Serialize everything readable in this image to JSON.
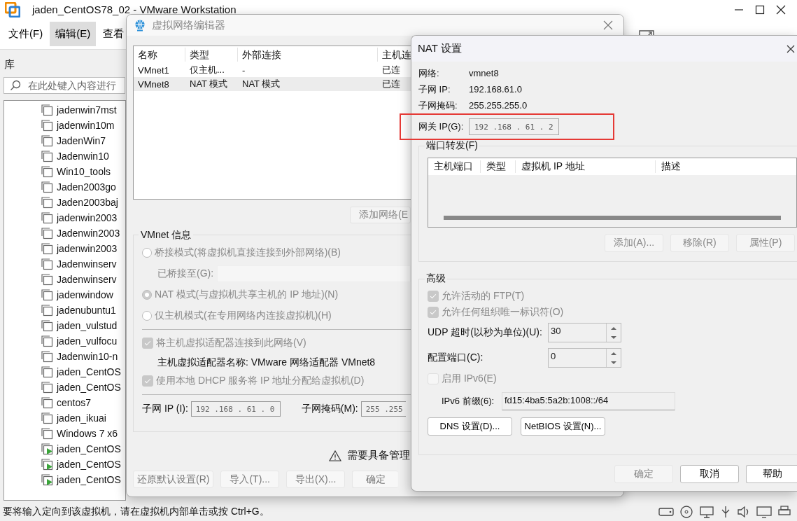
{
  "main_window": {
    "title": "jaden_CentOS78_02 - VMware Workstation",
    "menu": [
      {
        "label": "文件(F)",
        "selected": false
      },
      {
        "label": "编辑(E)",
        "selected": true
      },
      {
        "label": "查看",
        "selected": false
      }
    ],
    "library": {
      "title": "库",
      "search_placeholder": "在此处键入内容进行",
      "items": [
        {
          "name": "jadenwin7mst",
          "running": false
        },
        {
          "name": "jadenwin10m",
          "running": false
        },
        {
          "name": "JadenWin7",
          "running": false
        },
        {
          "name": "Jadenwin10",
          "running": false
        },
        {
          "name": "Win10_tools",
          "running": false
        },
        {
          "name": "Jaden2003go",
          "running": false
        },
        {
          "name": "Jaden2003baj",
          "running": false
        },
        {
          "name": "jadenwin2003",
          "running": false
        },
        {
          "name": "Jadenwin2003",
          "running": false
        },
        {
          "name": "jadenwin2003",
          "running": false
        },
        {
          "name": "Jadenwinserv",
          "running": false
        },
        {
          "name": "Jadenwinserv",
          "running": false
        },
        {
          "name": "jadenwindow",
          "running": false
        },
        {
          "name": "jadenubuntu1",
          "running": false
        },
        {
          "name": "jaden_vulstud",
          "running": false
        },
        {
          "name": "jaden_vulfocu",
          "running": false
        },
        {
          "name": "Jadenwin10-n",
          "running": false
        },
        {
          "name": "jaden_CentOS",
          "running": false
        },
        {
          "name": "jaden_CentOS",
          "running": false
        },
        {
          "name": "centos7",
          "running": false
        },
        {
          "name": "jaden_ikuai",
          "running": false
        },
        {
          "name": "Windows 7 x6",
          "running": false
        },
        {
          "name": "jaden_CentOS",
          "running": true
        },
        {
          "name": "jaden_CentOS",
          "running": true
        },
        {
          "name": "jaden_CentOS",
          "running": true
        }
      ]
    },
    "status_bar": "要将输入定向到该虚拟机，请在虚拟机内部单击或按 Ctrl+G。"
  },
  "network_editor": {
    "title": "虚拟网络编辑器",
    "columns": [
      "名称",
      "类型",
      "外部连接",
      "主机连"
    ],
    "rows": [
      {
        "cells": [
          "VMnet1",
          "仅主机...",
          "-",
          "已连"
        ],
        "selected": false
      },
      {
        "cells": [
          "VMnet8",
          "NAT 模式",
          "NAT 模式",
          "已连"
        ],
        "selected": true
      }
    ],
    "add_button": "添加网络(E",
    "vmnet_info": {
      "title": "VMnet 信息",
      "disabled": true,
      "modes": [
        {
          "label": "桥接模式(将虚拟机直接连接到外部网络)(B)",
          "selected": false
        },
        {
          "label": "NAT 模式(与虚拟机共享主机的 IP 地址)(N)",
          "selected": true
        },
        {
          "label": "仅主机模式(在专用网络内连接虚拟机)(H)",
          "selected": false
        }
      ],
      "bridged_to": "已桥接至(G):",
      "options": [
        {
          "label": "将主机虚拟适配器连接到此网络(V)",
          "checked": true
        },
        {
          "label": "使用本地 DHCP 服务将 IP 地址分配给虚拟机(D)",
          "checked": true
        }
      ],
      "adapter_name": "主机虚拟适配器名称: VMware 网络适配器 VMnet8",
      "subnet_ip": {
        "label": "子网 IP (I):",
        "value": "192 .168 . 61 . 0"
      },
      "subnet_mask": {
        "label": "子网掩码(M):",
        "value": "255 .255"
      }
    },
    "warning": "需要具备管理",
    "buttons": [
      "还原默认设置(R)",
      "导入(T)...",
      "导出(X)...",
      "确定"
    ]
  },
  "nat_settings": {
    "title": "NAT 设置",
    "info": [
      {
        "label": "网络:",
        "value": "vmnet8"
      },
      {
        "label": "子网 IP:",
        "value": "192.168.61.0"
      },
      {
        "label": "子网掩码:",
        "value": "255.255.255.0"
      }
    ],
    "gateway": {
      "label": "网关 IP(G):",
      "value": "192 .168 . 61 . 2"
    },
    "port_forwarding": {
      "title": "端口转发(F)",
      "columns": [
        "主机端口",
        "类型",
        "虚拟机 IP 地址",
        "描述"
      ],
      "buttons": [
        {
          "label": "添加(A)...",
          "disabled": true
        },
        {
          "label": "移除(R)",
          "disabled": true
        },
        {
          "label": "属性(P)",
          "disabled": true
        }
      ]
    },
    "advanced": {
      "title": "高级",
      "checks": [
        {
          "label": "允许活动的 FTP(T)",
          "checked": true,
          "disabled": true
        },
        {
          "label": "允许任何组织唯一标识符(O)",
          "checked": true,
          "disabled": true
        }
      ],
      "spinners": [
        {
          "label": "UDP 超时(以秒为单位)(U):",
          "value": "30"
        },
        {
          "label": "配置端口(C):",
          "value": "0"
        }
      ],
      "ipv6": {
        "label": "启用 IPv6(E)",
        "checked": false,
        "disabled": true
      },
      "prefix": {
        "label": "IPv6 前缀(6):",
        "value": "fd15:4ba5:5a2b:1008::/64"
      },
      "buttons": [
        "DNS 设置(D)...",
        "NetBIOS 设置(N)..."
      ]
    },
    "footer": [
      {
        "label": "确定",
        "disabled": true
      },
      {
        "label": "取消",
        "disabled": false
      },
      {
        "label": "帮助",
        "disabled": false
      }
    ]
  }
}
